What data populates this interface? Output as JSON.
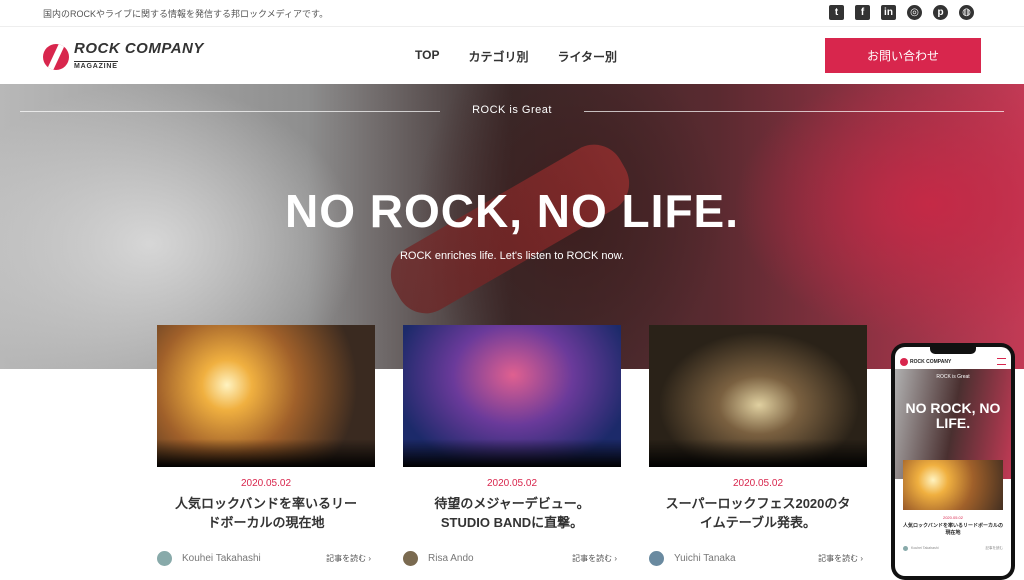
{
  "topbar": {
    "tagline": "国内のROCKやライブに関する情報を発信する邦ロックメディアです。",
    "social_icons": [
      "twitter-icon",
      "facebook-icon",
      "linkedin-icon",
      "instagram-icon",
      "pinterest-icon",
      "dribbble-icon"
    ]
  },
  "header": {
    "logo_main": "ROCK COMPANY",
    "logo_sub": "MAGAZINE",
    "nav": [
      "TOP",
      "カテゴリ別",
      "ライター別"
    ],
    "cta": "お問い合わせ"
  },
  "hero": {
    "kicker": "ROCK is Great",
    "title": "NO ROCK, NO LIFE.",
    "subtitle": "ROCK enriches life. Let's listen to ROCK now."
  },
  "cards": [
    {
      "date": "2020.05.02",
      "title": "人気ロックバンドを率いるリードボーカルの現在地",
      "author": "Kouhei Takahashi",
      "read_more": "記事を読む ›"
    },
    {
      "date": "2020.05.02",
      "title": "待望のメジャーデビュー。STUDIO BANDに直撃。",
      "author": "Risa Ando",
      "read_more": "記事を読む ›"
    },
    {
      "date": "2020.05.02",
      "title": "スーパーロックフェス2020のタイムテーブル発表。",
      "author": "Yuichi Tanaka",
      "read_more": "記事を読む ›"
    }
  ],
  "phone": {
    "logo": "ROCK COMPANY",
    "kicker": "ROCK is Great",
    "title": "NO ROCK, NO LIFE.",
    "date": "2020.05.02",
    "card_title": "人気ロックバンドを率いるリードボーカルの現在地",
    "author": "Kouhei Takahashi",
    "read_more": "記事を読む"
  },
  "colors": {
    "accent": "#d8264d"
  }
}
